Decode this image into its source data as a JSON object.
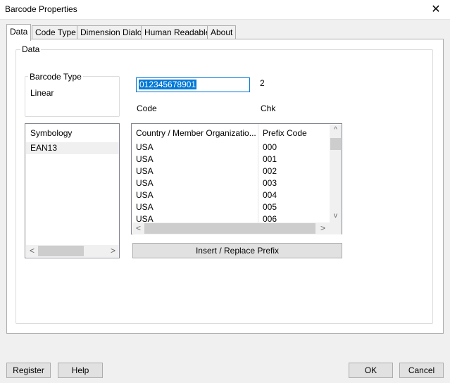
{
  "window": {
    "title": "Barcode Properties",
    "close_glyph": "✕"
  },
  "tabs": [
    {
      "label": "Data",
      "active": true
    },
    {
      "label": "Code Type"
    },
    {
      "label": "Dimension Dialog"
    },
    {
      "label": "Human Readable"
    },
    {
      "label": "About"
    }
  ],
  "data_group": {
    "caption": "Data",
    "barcode_type": {
      "caption": "Barcode Type",
      "value": "Linear"
    },
    "code": {
      "value": "012345678901",
      "label": "Code"
    },
    "check": {
      "value": "2",
      "label": "Chk"
    },
    "symbology": {
      "header": "Symbology",
      "items": [
        "EAN13"
      ]
    },
    "prefix_table": {
      "columns": [
        "Country / Member Organizatio...",
        "Prefix Code"
      ],
      "rows": [
        [
          "USA",
          "000"
        ],
        [
          "USA",
          "001"
        ],
        [
          "USA",
          "002"
        ],
        [
          "USA",
          "003"
        ],
        [
          "USA",
          "004"
        ],
        [
          "USA",
          "005"
        ],
        [
          "USA",
          "006"
        ]
      ]
    },
    "insert_button": "Insert / Replace  Prefix"
  },
  "footer": {
    "register": "Register",
    "help": "Help",
    "ok": "OK",
    "cancel": "Cancel"
  },
  "scroll_glyphs": {
    "left": "<",
    "right": ">",
    "up": "^",
    "down": "v"
  }
}
